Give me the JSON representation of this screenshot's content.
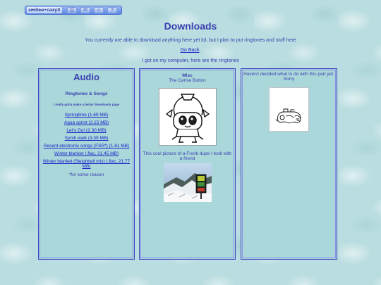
{
  "toolbar": {
    "site_label": "smilee•cazyX",
    "buttons": [
      {
        "icon": "printer-icon",
        "glyph": "⎙"
      },
      {
        "icon": "mail-icon",
        "glyph": "✉"
      },
      {
        "icon": "user-icon",
        "glyph": "☺"
      },
      {
        "icon": "help-icon",
        "glyph": "?"
      }
    ]
  },
  "header": {
    "title": "Downloads",
    "intro": "You currently are able to download anything here yet lol, but I plan to put ringtones and stuff here",
    "go_back": "Go Back",
    "go_back_suffix": ".",
    "note": "I got on my computer, here are the ringtones"
  },
  "audio": {
    "title": "Audio",
    "section": "Ringtones & Songs",
    "better_page": "I really gotta make a better downloads page",
    "songs": [
      "Springtime (1.69 MB)",
      "Aqua sprint (2.15 MB)",
      "Let's Go! (2.30 MB)",
      "Synth walk (3.39 MB)",
      "Recent electronic songs (FSR*) (1.61 MB)",
      "Winter blanket (.flac, 21.45 MB)",
      "Winter blanket (Sleighbell mix) (.flac, 21.77 MB)"
    ],
    "footnote": "*for some reason"
  },
  "misc": {
    "title": "Misc",
    "subtitle": "The Cerise Button",
    "photo_caption": "This cool picture of a Fronk dupe I took with a friend"
  },
  "third": {
    "text": "Haven't decided what to do with this part yet. Sorry"
  }
}
